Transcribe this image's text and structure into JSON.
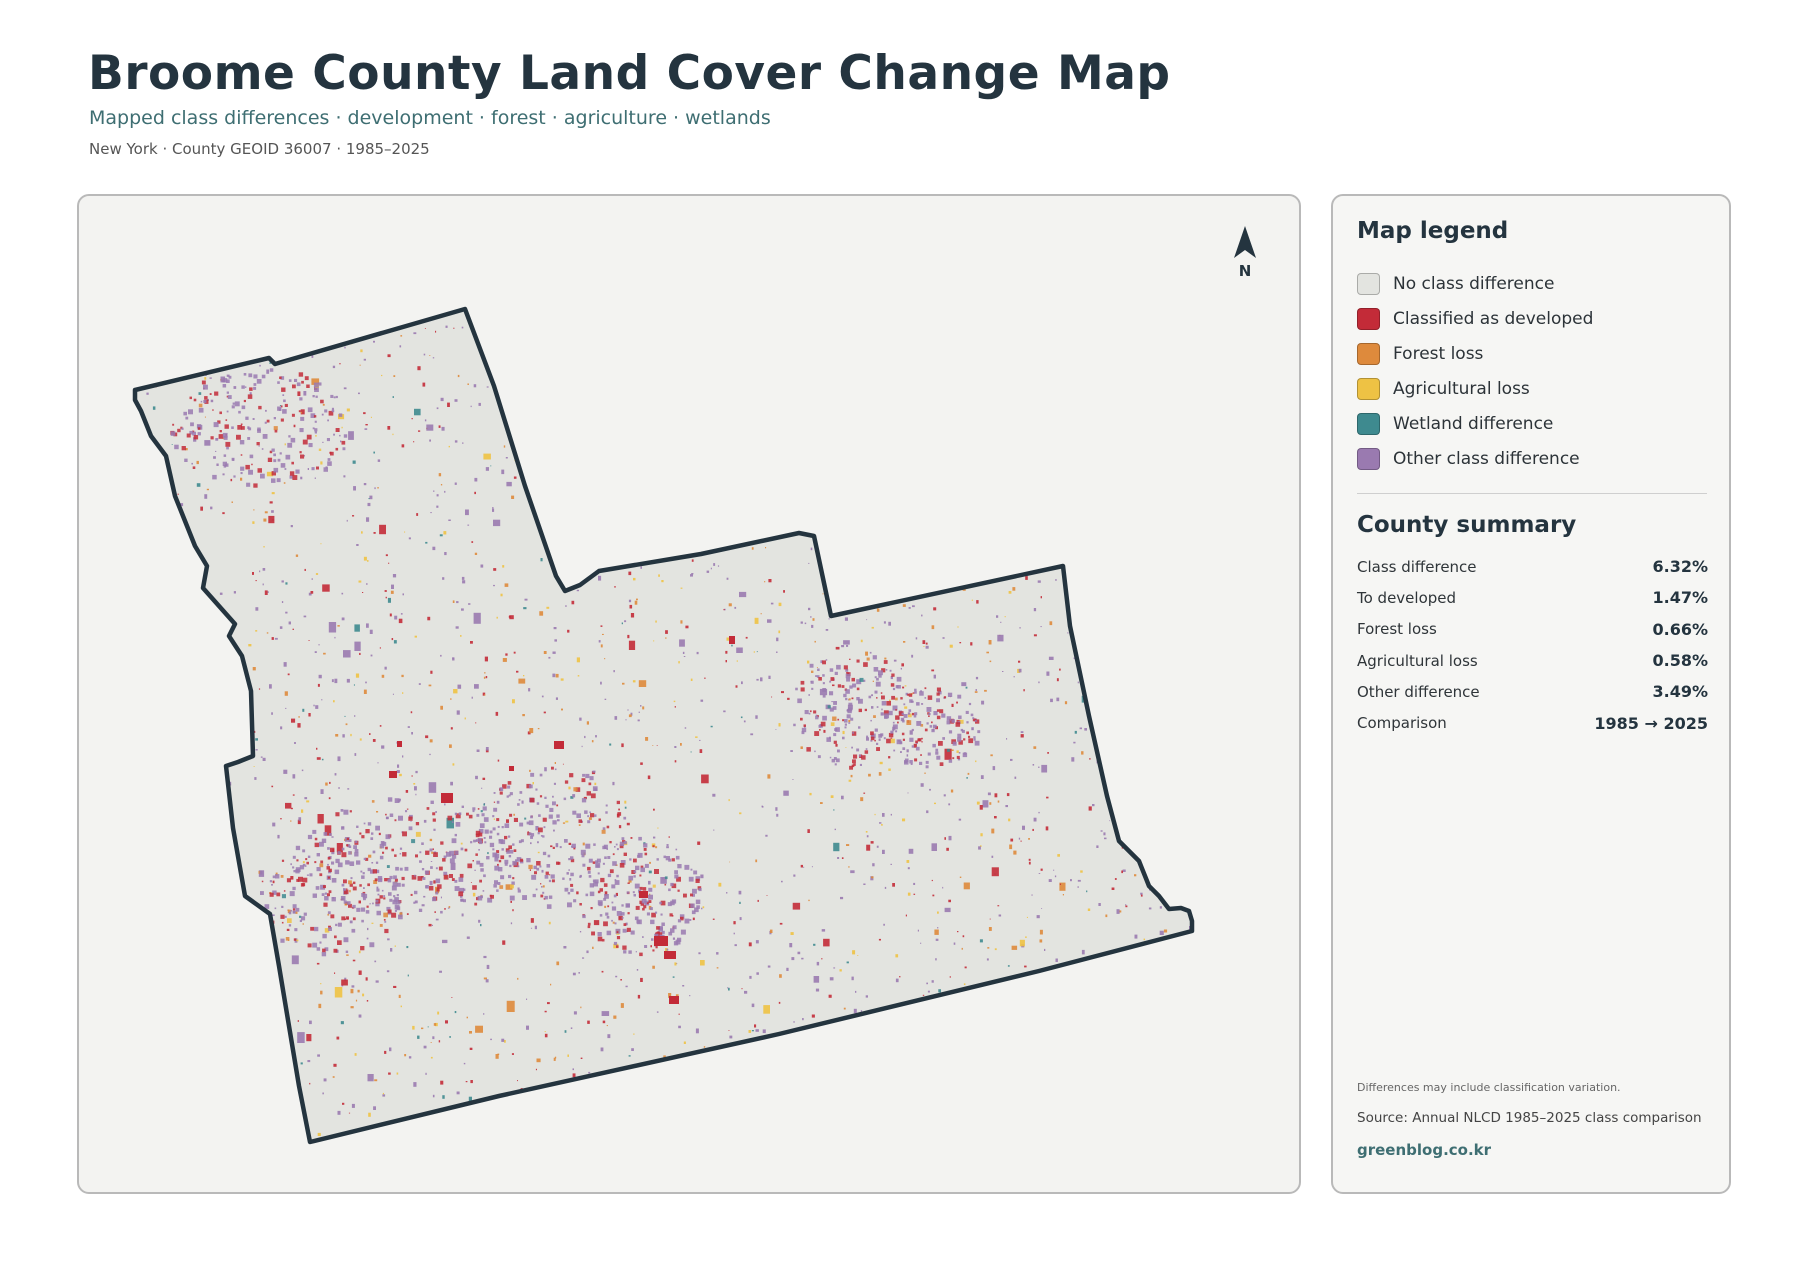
{
  "header": {
    "title": "Broome County Land Cover Change Map",
    "subtitle": "Mapped class differences · development · forest · agriculture · wetlands",
    "meta": "New York · County GEOID 36007 · 1985–2025"
  },
  "map": {
    "north_label": "N",
    "colors": {
      "no_difference": "#e3e4e0",
      "developed": "#c32b38",
      "forest_loss": "#de8a3c",
      "agricultural_loss": "#eec244",
      "wetland_difference": "#3e8a8f",
      "other_difference": "#9a7ab0",
      "boundary": "#24343f"
    }
  },
  "legend": {
    "title": "Map legend",
    "items": [
      {
        "label": "No class difference",
        "color": "#e3e4e0"
      },
      {
        "label": "Classified as developed",
        "color": "#c32b38"
      },
      {
        "label": "Forest loss",
        "color": "#de8a3c"
      },
      {
        "label": "Agricultural loss",
        "color": "#eec244"
      },
      {
        "label": "Wetland difference",
        "color": "#3e8a8f"
      },
      {
        "label": "Other class difference",
        "color": "#9a7ab0"
      }
    ]
  },
  "summary": {
    "title": "County summary",
    "rows": [
      {
        "label": "Class difference",
        "value": "6.32%"
      },
      {
        "label": "To developed",
        "value": "1.47%"
      },
      {
        "label": "Forest loss",
        "value": "0.66%"
      },
      {
        "label": "Agricultural loss",
        "value": "0.58%"
      },
      {
        "label": "Other difference",
        "value": "3.49%"
      },
      {
        "label": "Comparison",
        "value": "1985 → 2025"
      }
    ]
  },
  "footer": {
    "note": "Differences may include classification variation.",
    "source": "Source: Annual NLCD 1985–2025 class comparison",
    "credit": "greenblog.co.kr"
  }
}
